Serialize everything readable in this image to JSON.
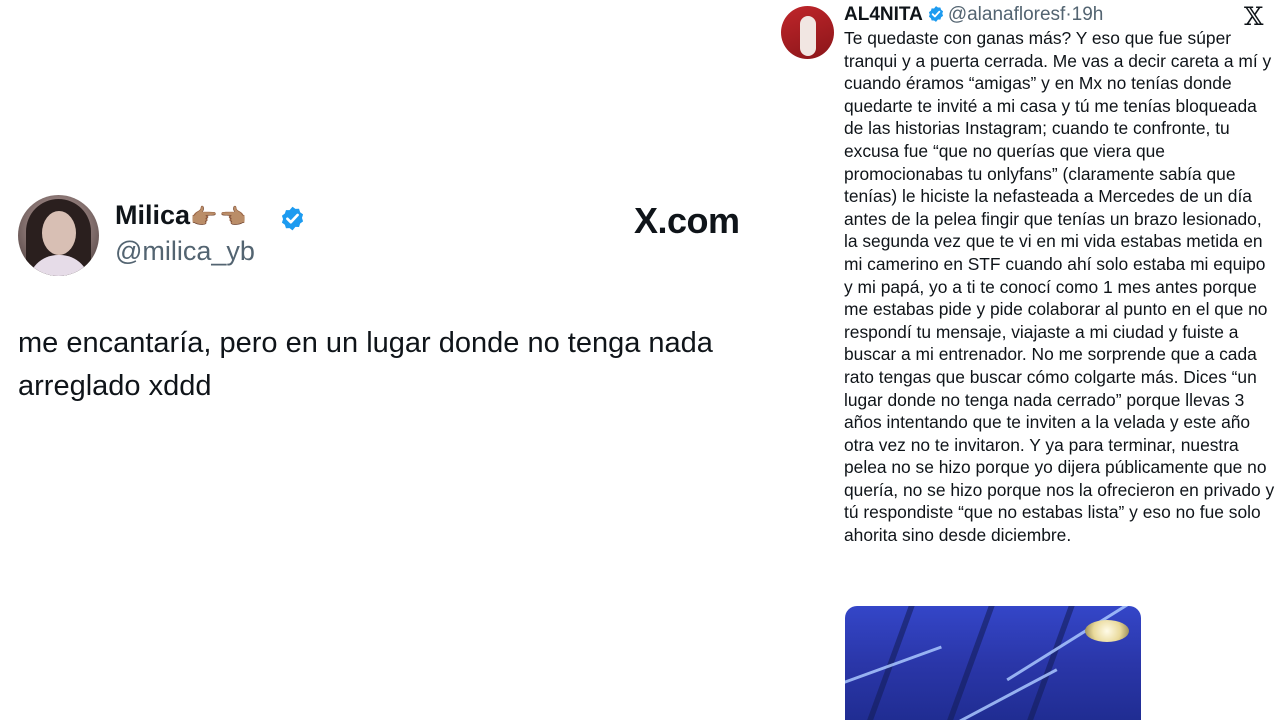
{
  "left_tweet": {
    "name": "Milica",
    "name_emojis": "👉🏽👈🏽",
    "handle": "@milica_yb",
    "source": "X.com",
    "text": "me encantaría, pero en un lugar donde no tenga nada arreglado xddd",
    "icons": [
      "avatar",
      "verified-badge-icon"
    ]
  },
  "right_tweet": {
    "name": "AL4NITA",
    "handle": "@alanafloresf",
    "separator": "·",
    "time": "19h",
    "text": "Te quedaste con ganas más? Y eso que fue súper tranqui y a puerta cerrada. Me vas a decir careta a mí y cuando éramos “amigas” y en Mx no tenías donde quedarte te invité a mi casa y tú me tenías bloqueada de las historias Instagram; cuando te confronte, tu excusa fue “que no querías que viera que promocionabas tu onlyfans” (claramente sabía que tenías) le hiciste la nefasteada a Mercedes de un día antes de la pelea fingir que tenías un brazo lesionado, la segunda vez que te vi en mi vida estabas metida en mi camerino en STF cuando ahí solo estaba mi equipo y mi papá, yo a ti te conocí como 1 mes antes porque me estabas pide y pide colaborar al punto en el que no respondí tu mensaje, viajaste a mi ciudad y fuiste a buscar a mi entrenador. No me sorprende que a cada rato tengas que buscar cómo colgarte más. Dices “un lugar donde no tenga nada cerrado” porque llevas 3 años intentando que te inviten a la velada y este año otra vez no te invitaron. Y ya para terminar, nuestra pelea no se hizo porque yo dijera públicamente que no quería, no se hizo porque nos la ofrecieron en privado y tú respondiste “que no estabas lista” y eso no fue solo ahorita sino desde diciembre.",
    "x_logo": "𝕏",
    "icons": [
      "avatar",
      "verified-badge-icon",
      "x-logo-icon"
    ],
    "colors": {
      "verified": "#1d9bf0",
      "secondary_text": "#536471",
      "media_blue": "#2a36a8"
    }
  }
}
